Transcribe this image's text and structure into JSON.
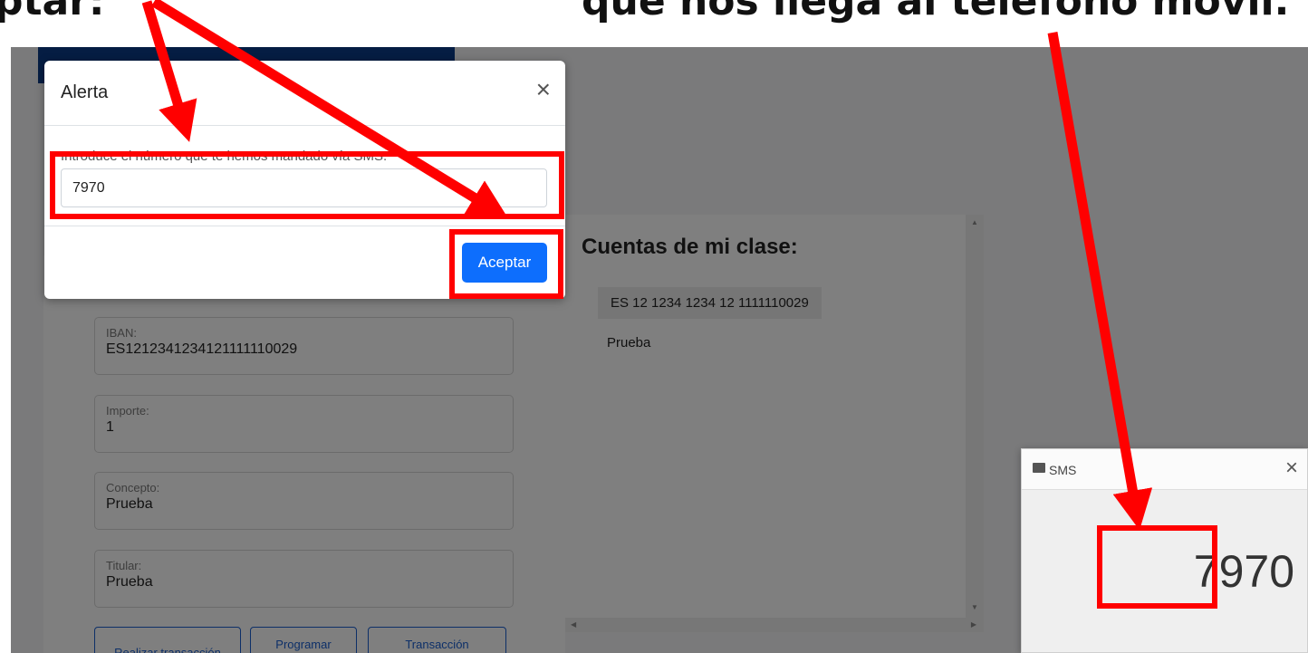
{
  "captions": {
    "left": "ptar:",
    "right": "que nos llega al teléfono móvil."
  },
  "form": {
    "fields": [
      {
        "label": "IBAN:",
        "value": "ES1212341234121111110029"
      },
      {
        "label": "Importe:",
        "value": "1"
      },
      {
        "label": "Concepto:",
        "value": "Prueba"
      },
      {
        "label": "Titular:",
        "value": "Prueba"
      }
    ],
    "buttons": [
      "Realizar transacción",
      "Programar",
      "Transacción"
    ]
  },
  "accounts": {
    "title": "Cuentas de mi clase:",
    "iban": "ES 12 1234 1234 12 1111110029",
    "name": "Prueba"
  },
  "modal": {
    "title": "Alerta",
    "prompt": "Introduce el número que te hemos mandado vía SMS.",
    "input_value": "7970",
    "accept_label": "Aceptar",
    "close_symbol": "×"
  },
  "sms": {
    "title": "SMS",
    "code": "7970",
    "close_symbol": "×"
  },
  "colors": {
    "annotation": "#ff0000",
    "primary": "#0d6efd",
    "header_blue": "#0b3a86"
  }
}
